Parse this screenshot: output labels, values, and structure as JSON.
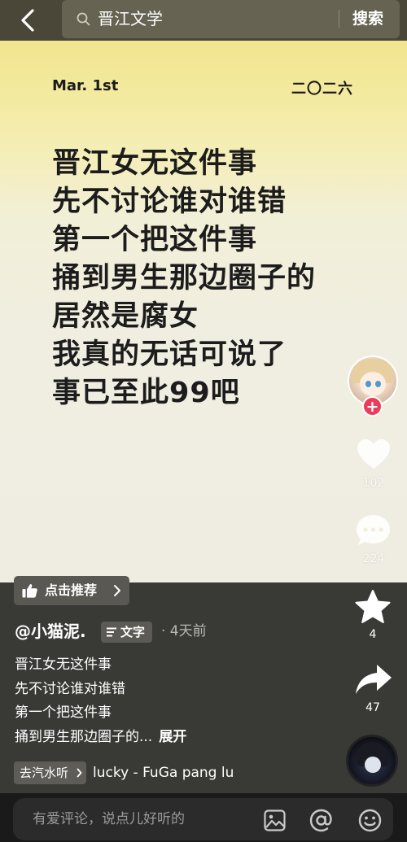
{
  "search": {
    "query": "晋江文学",
    "button": "搜索"
  },
  "poster": {
    "date": "Mar. 1st",
    "year": "二〇二六",
    "lines": [
      "晋江女无这件事",
      "先不讨论谁对谁错",
      "第一个把这件事",
      "捅到男生那边圈子的",
      "居然是腐女",
      "我真的无话可说了",
      "事已至此99吧"
    ]
  },
  "actions": {
    "follow": "+",
    "likes": "102",
    "comments": "224",
    "favorites": "4",
    "shares": "47"
  },
  "recommend": {
    "label": "点击推荐"
  },
  "post": {
    "author": "@小猫泥.",
    "type_tag": "文字",
    "time": "· 4天前",
    "desc_lines": [
      "晋江女无这件事",
      "先不讨论谁对谁错",
      "第一个把这件事",
      "捅到男生那边圈子的..."
    ],
    "expand": "展开"
  },
  "music": {
    "tag": "去汽水听",
    "title": "lucky - FuGa pang    lu"
  },
  "comment": {
    "placeholder": "有爱评论，说点儿好听的"
  },
  "icons": [
    "back-icon",
    "search-icon",
    "heart-icon",
    "comment-icon",
    "star-icon",
    "share-icon",
    "thumb-up-icon",
    "image-icon",
    "at-icon",
    "emoji-icon"
  ]
}
